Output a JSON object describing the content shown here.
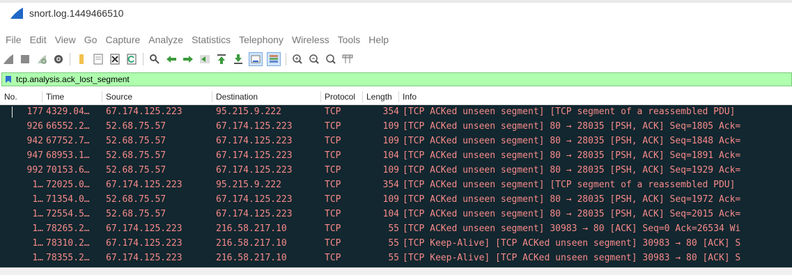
{
  "window": {
    "title": "snort.log.1449466510"
  },
  "menu": [
    "File",
    "Edit",
    "View",
    "Go",
    "Capture",
    "Analyze",
    "Statistics",
    "Telephony",
    "Wireless",
    "Tools",
    "Help"
  ],
  "filter": {
    "value": "tcp.analysis.ack_lost_segment"
  },
  "columns": [
    "No.",
    "Time",
    "Source",
    "Destination",
    "Protocol",
    "Length",
    "Info"
  ],
  "colors": {
    "row_bg": "#12272f",
    "row_fg": "#f78a8a",
    "filter_bg": "#afffaf"
  },
  "packets": [
    {
      "no": "177",
      "time": "4329.04…",
      "source": "67.174.125.223",
      "destination": "95.215.9.222",
      "protocol": "TCP",
      "length": "354",
      "info": "[TCP ACKed unseen segment] [TCP segment of a reassembled PDU]"
    },
    {
      "no": "926",
      "time": "66552.2…",
      "source": "52.68.75.57",
      "destination": "67.174.125.223",
      "protocol": "TCP",
      "length": "109",
      "info": "[TCP ACKed unseen segment] 80 → 28035 [PSH, ACK] Seq=1805 Ack="
    },
    {
      "no": "942",
      "time": "67752.7…",
      "source": "52.68.75.57",
      "destination": "67.174.125.223",
      "protocol": "TCP",
      "length": "109",
      "info": "[TCP ACKed unseen segment] 80 → 28035 [PSH, ACK] Seq=1848 Ack="
    },
    {
      "no": "947",
      "time": "68953.1…",
      "source": "52.68.75.57",
      "destination": "67.174.125.223",
      "protocol": "TCP",
      "length": "104",
      "info": "[TCP ACKed unseen segment] 80 → 28035 [PSH, ACK] Seq=1891 Ack="
    },
    {
      "no": "992",
      "time": "70153.6…",
      "source": "52.68.75.57",
      "destination": "67.174.125.223",
      "protocol": "TCP",
      "length": "109",
      "info": "[TCP ACKed unseen segment] 80 → 28035 [PSH, ACK] Seq=1929 Ack="
    },
    {
      "no": "1…",
      "time": "72025.0…",
      "source": "67.174.125.223",
      "destination": "95.215.9.222",
      "protocol": "TCP",
      "length": "354",
      "info": "[TCP ACKed unseen segment] [TCP segment of a reassembled PDU]"
    },
    {
      "no": "1…",
      "time": "71354.0…",
      "source": "52.68.75.57",
      "destination": "67.174.125.223",
      "protocol": "TCP",
      "length": "109",
      "info": "[TCP ACKed unseen segment] 80 → 28035 [PSH, ACK] Seq=1972 Ack="
    },
    {
      "no": "1…",
      "time": "72554.5…",
      "source": "52.68.75.57",
      "destination": "67.174.125.223",
      "protocol": "TCP",
      "length": "104",
      "info": "[TCP ACKed unseen segment] 80 → 28035 [PSH, ACK] Seq=2015 Ack="
    },
    {
      "no": "1…",
      "time": "78265.2…",
      "source": "67.174.125.223",
      "destination": "216.58.217.10",
      "protocol": "TCP",
      "length": "55",
      "info": "[TCP ACKed unseen segment] 30983 → 80 [ACK] Seq=0 Ack=26534 Wi"
    },
    {
      "no": "1…",
      "time": "78310.2…",
      "source": "67.174.125.223",
      "destination": "216.58.217.10",
      "protocol": "TCP",
      "length": "55",
      "info": "[TCP Keep-Alive] [TCP ACKed unseen segment] 30983 → 80 [ACK] S"
    },
    {
      "no": "1…",
      "time": "78355.2…",
      "source": "67.174.125.223",
      "destination": "216.58.217.10",
      "protocol": "TCP",
      "length": "55",
      "info": "[TCP Keep-Alive] [TCP ACKed unseen segment] 30983 → 80 [ACK] S"
    }
  ]
}
